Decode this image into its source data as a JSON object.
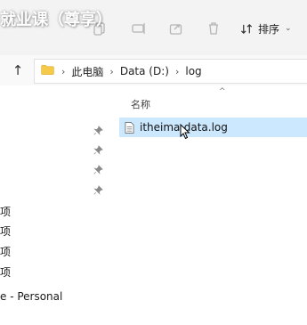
{
  "window": {
    "title_overlay": "就业课（尊享）"
  },
  "toolbar": {
    "sort_label": "排序",
    "icons": [
      "share-icon",
      "copy-icon",
      "rename-icon",
      "share-out-icon",
      "delete-icon",
      "sort-icon"
    ]
  },
  "address": {
    "crumbs": [
      "此电脑",
      "Data (D:)",
      "log"
    ]
  },
  "nav": {
    "items": [
      "项",
      "项",
      "项",
      "项"
    ],
    "onedrive": "e - Personal"
  },
  "list": {
    "column_name": "名称",
    "files": [
      {
        "name": "itheima-data.log"
      }
    ]
  },
  "colors": {
    "selection": "#cce8ff",
    "toolbar_bg": "#f3f3f3",
    "folder_yellow": "#f7c948"
  }
}
